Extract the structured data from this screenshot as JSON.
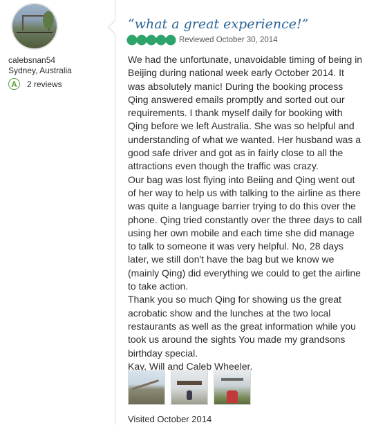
{
  "profile": {
    "username": "calebsnan54",
    "location": "Sydney, Australia",
    "reviews_count": "2 reviews"
  },
  "review": {
    "title": "“what a great experience!”",
    "rating": 5,
    "rating_max": 5,
    "reviewed_date": "Reviewed October 30, 2014",
    "paragraphs": [
      "We had the unfortunate, unavoidable timing of being in Beijing during national week early October 2014. It was absolutely manic! During the booking process Qing answered emails promptly and sorted out our requirements. I thank myself daily for booking with Qing before we left Australia. She was so helpful and understanding of what we wanted. Her husband was a good safe driver and got as in fairly close to all the attractions even though the traffic was crazy.",
      "Our bag was lost flying into Beiing and Qing went out of her way to help us with talking to the airline as there was quite a language barrier trying to do this over the phone. Qing tried constantly over the three days to call using her own mobile and each time she did manage to talk to someone it was very helpful. No, 28 days later, we still don't have the bag but we know we (mainly Qing) did everything we could to get the airline to take action.",
      "Thank you so much Qing for showing us the great acrobatic show and the lunches at the two local restaurants as well as the great information while you took us around the sights You made my grandsons birthday special.",
      "Kay, Will and Caleb Wheeler."
    ],
    "visited": "Visited October 2014",
    "photos": [
      "great-wall-photo",
      "pagoda-photo",
      "gate-photo"
    ]
  },
  "colors": {
    "title": "#2a6496",
    "bubble": "#2ea36a",
    "badge": "#5b9c3e"
  }
}
